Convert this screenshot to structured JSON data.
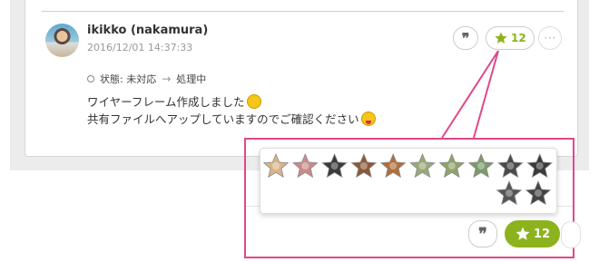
{
  "comment": {
    "user_name": "ikikko (nakamura)",
    "timestamp": "2016/12/01 14:37:33",
    "status": {
      "label": "状態: 未対応",
      "arrow": "→",
      "new_status": "処理中"
    },
    "lines": [
      "ワイヤーフレーム作成しました",
      "共有ファイルへアップしていますのでご確認ください"
    ],
    "star_count": "12",
    "quote_glyph": "❞",
    "more_glyph": "⋯"
  },
  "callout": {
    "star_count": "12",
    "quote_glyph": "❞",
    "accent_color": "#e0488a",
    "star_color": "#8cb31d",
    "stargazers": [
      {
        "tint": "#d9b48a"
      },
      {
        "tint": "#c98a8a"
      },
      {
        "tint": "#3b3b3b"
      },
      {
        "tint": "#8a5a3a"
      },
      {
        "tint": "#b0703a"
      },
      {
        "tint": "#9aa87a"
      },
      {
        "tint": "#8fa36a"
      },
      {
        "tint": "#7c9a6a"
      },
      {
        "tint": "#4a4a4a"
      },
      {
        "tint": "#3a3a3a"
      },
      {
        "tint": "#555555"
      },
      {
        "tint": "#444444"
      }
    ]
  }
}
